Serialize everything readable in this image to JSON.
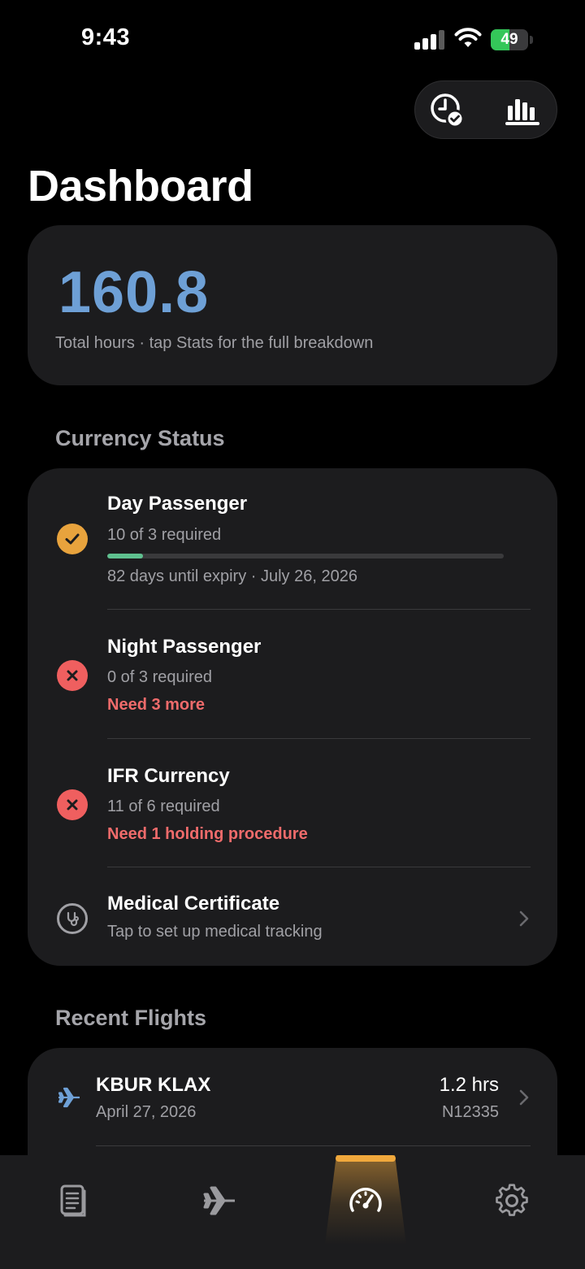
{
  "status_bar": {
    "time": "9:43",
    "battery": "49"
  },
  "page": {
    "title": "Dashboard"
  },
  "summary": {
    "total_hours": "160.8",
    "caption": "Total hours · tap Stats for the full breakdown"
  },
  "currency": {
    "section_title": "Currency Status",
    "items": [
      {
        "title": "Day Passenger",
        "subtitle": "10 of 3 required",
        "progress": 0.09,
        "detail": "82 days until expiry · July 26, 2026",
        "status": "current"
      },
      {
        "title": "Night Passenger",
        "subtitle": "0 of 3 required",
        "warning": "Need 3 more",
        "status": "not-current"
      },
      {
        "title": "IFR Currency",
        "subtitle": "11 of 6 required",
        "warning": "Need 1 holding procedure",
        "status": "not-current"
      },
      {
        "title": "Medical Certificate",
        "subtitle": "Tap to set up medical tracking",
        "status": "not-set"
      }
    ]
  },
  "recent_flights": {
    "section_title": "Recent Flights",
    "items": [
      {
        "route": "KBUR KLAX",
        "date": "April 27, 2026",
        "hours": "1.2 hrs",
        "tail": "N12335"
      }
    ]
  },
  "tabs": [
    {
      "icon": "logbook-icon",
      "active": false
    },
    {
      "icon": "airplane-icon",
      "active": false
    },
    {
      "icon": "speedometer-icon",
      "active": true
    },
    {
      "icon": "gear-icon",
      "active": false
    }
  ],
  "colors": {
    "accent": "#f0a83c",
    "hours": "#6ea0d6",
    "warning": "#ef6b6b",
    "progress": "#5fc08f",
    "card": "#1c1c1e"
  }
}
